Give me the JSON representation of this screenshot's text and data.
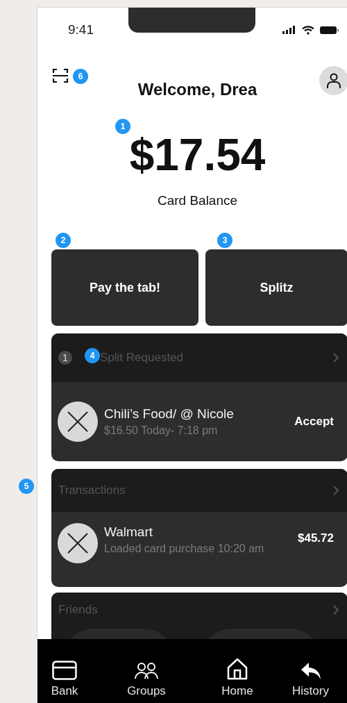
{
  "status_bar": {
    "time": "9:41"
  },
  "header": {
    "title": "Welcome, Drea"
  },
  "balance": {
    "amount": "$17.54",
    "label": "Card Balance"
  },
  "actions": [
    {
      "label": "Pay the tab!"
    },
    {
      "label": "Splitz"
    }
  ],
  "split_requests": {
    "count": "1",
    "title": "Split Requested",
    "items": [
      {
        "title": "Chili’s Food/ @ Nicole",
        "subtitle": "$16.50 Today- 7:18 pm",
        "action": "Accept"
      }
    ]
  },
  "transactions": {
    "title": "Transactions",
    "items": [
      {
        "title": "Walmart",
        "subtitle": "Loaded card purchase 10:20 am",
        "amount": "$45.72"
      }
    ]
  },
  "friends": {
    "title": "Friends"
  },
  "tab_bar": [
    {
      "label": "Bank"
    },
    {
      "label": "Groups"
    },
    {
      "label": "Home"
    },
    {
      "label": "History"
    }
  ],
  "markers": [
    {
      "number": "6"
    },
    {
      "number": "1"
    },
    {
      "number": "2"
    },
    {
      "number": "3"
    },
    {
      "number": "4"
    },
    {
      "number": "5"
    }
  ]
}
